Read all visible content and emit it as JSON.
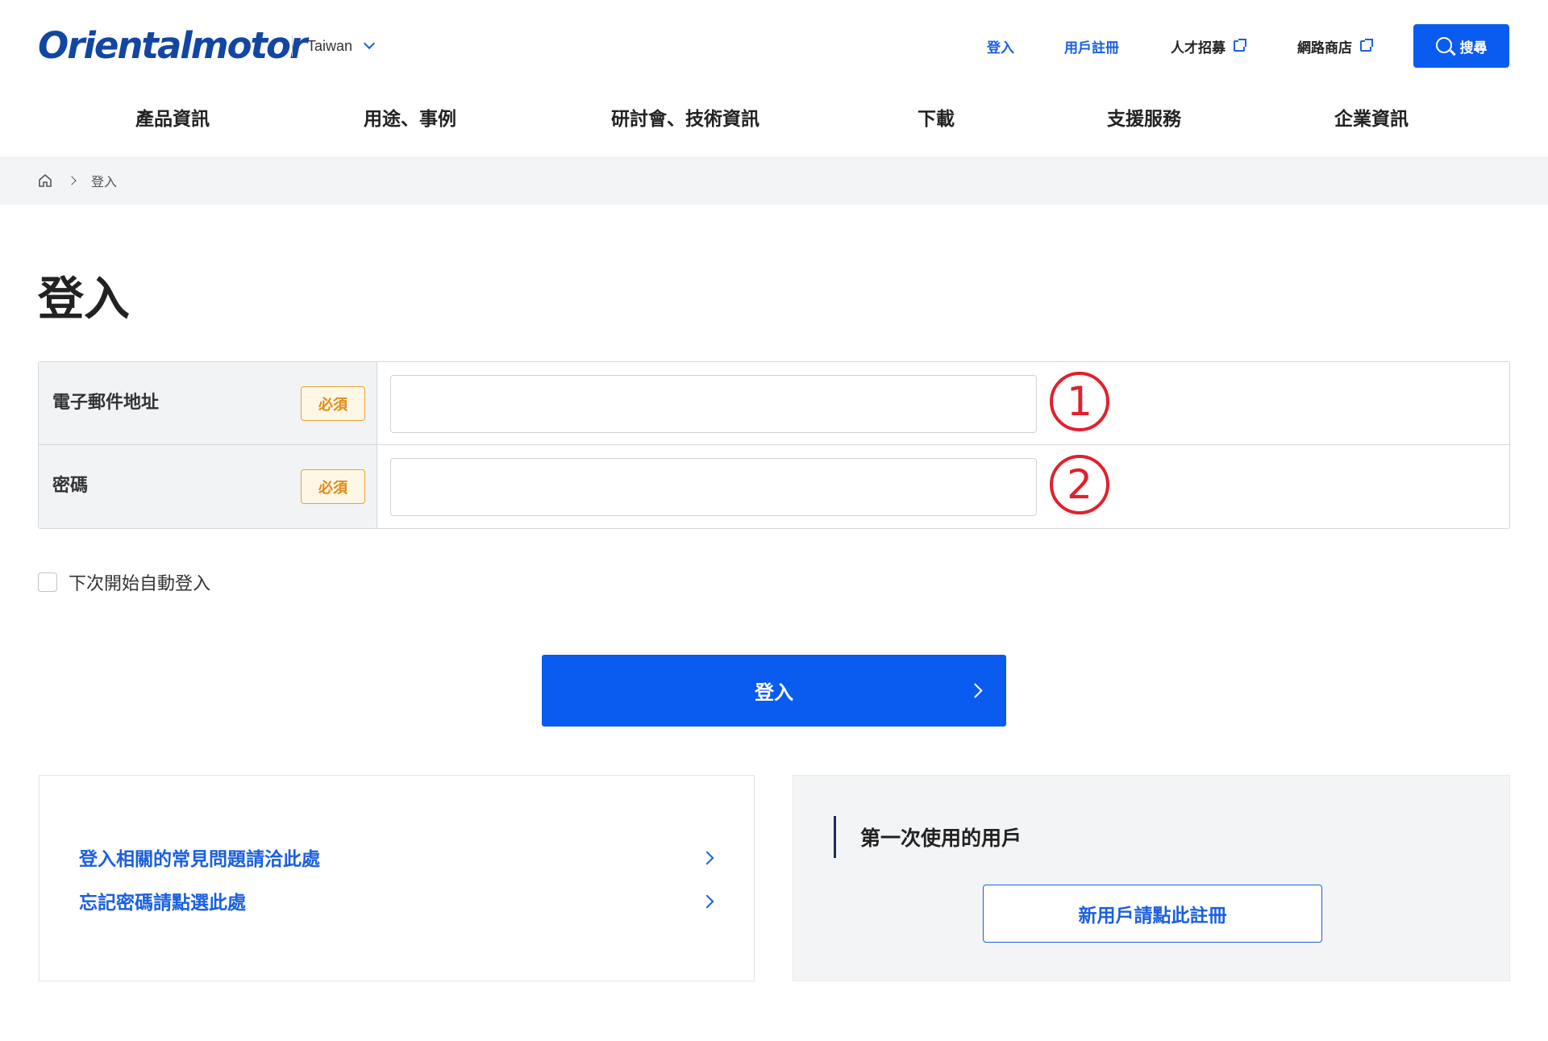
{
  "header": {
    "logo_text": "Orientalmotor",
    "region": "Taiwan",
    "links": {
      "login": "登入",
      "register": "用戶註冊",
      "careers": "人才招募",
      "shop": "網路商店"
    },
    "search_label": "搜尋"
  },
  "nav": {
    "items": [
      "產品資訊",
      "用途、事例",
      "研討會、技術資訊",
      "下載",
      "支援服務",
      "企業資訊"
    ]
  },
  "breadcrumb": {
    "current": "登入"
  },
  "page": {
    "title": "登入"
  },
  "form": {
    "email": {
      "label": "電子郵件地址",
      "required": "必須",
      "value": "",
      "marker": "1"
    },
    "password": {
      "label": "密碼",
      "required": "必須",
      "value": "",
      "marker": "2"
    },
    "remember_label": "下次開始自動登入",
    "remember_checked": false,
    "submit_label": "登入"
  },
  "help": {
    "faq_link": "登入相關的常見問題請洽此處",
    "forgot_link": "忘記密碼請點選此處"
  },
  "first_time": {
    "title": "第一次使用的用戶",
    "register_button": "新用戶請點此註冊"
  },
  "colors": {
    "brand_blue": "#0a5bf0",
    "logo_blue": "#1246a3",
    "required_orange": "#e08a16",
    "marker_red": "#e0212d"
  }
}
